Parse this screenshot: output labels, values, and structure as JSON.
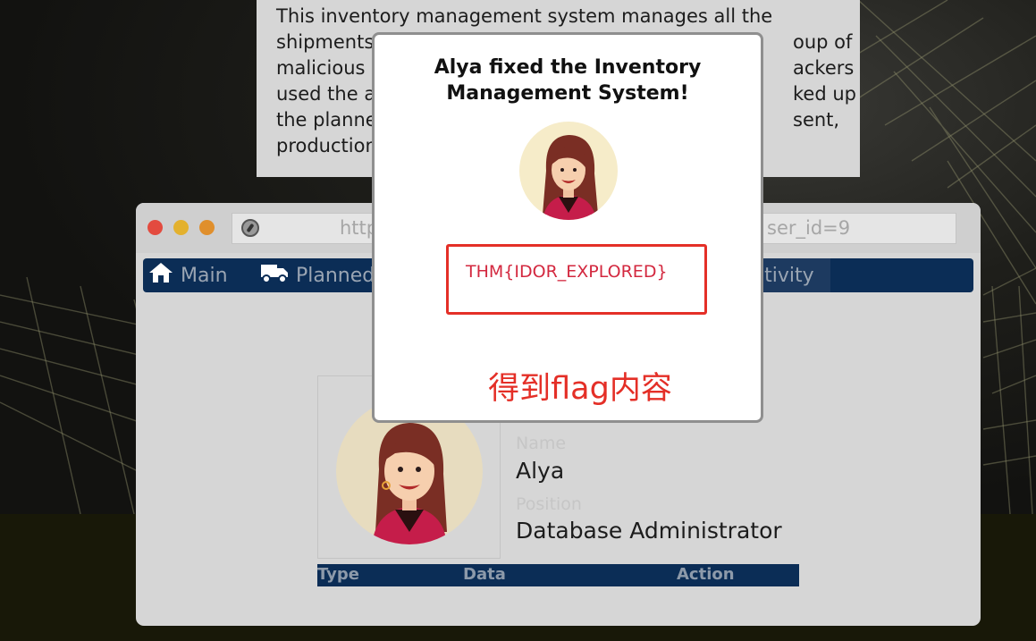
{
  "description": {
    "lines": [
      "This inventory management system manages all the",
      "shipments",
      "malicious",
      "used the a",
      "the planne",
      "production"
    ],
    "right_fragments": [
      "oup of",
      "ackers",
      "ked up",
      "sent,"
    ]
  },
  "browser": {
    "url_left": "http",
    "url_right": "ser_id=9"
  },
  "nav": {
    "main": "Main",
    "planned": "Planned",
    "activity": "ctivity"
  },
  "profile": {
    "name_label": "Name",
    "name": "Alya",
    "position_label": "Position",
    "position": "Database Administrator"
  },
  "table": {
    "columns": [
      "Type",
      "Data",
      "Action"
    ]
  },
  "modal": {
    "title_line1": "Alya fixed the Inventory",
    "title_line2": "Management System!",
    "flag": "THM{IDOR_EXPLORED}",
    "note": "得到flag内容"
  },
  "colors": {
    "nav_bg": "#0b2d56",
    "flag_border": "#e42f27",
    "flag_text": "#d3283f"
  }
}
